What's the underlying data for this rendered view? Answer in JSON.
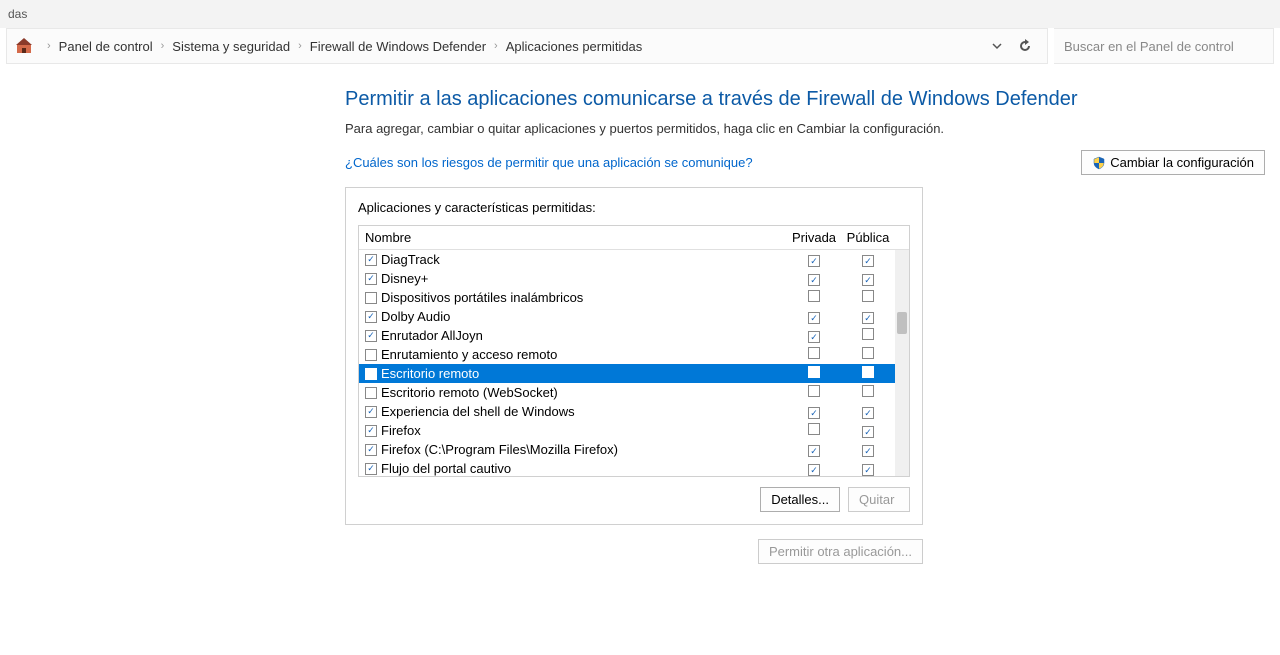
{
  "titlebar": {
    "text": "das"
  },
  "breadcrumb": {
    "items": [
      "Panel de control",
      "Sistema y seguridad",
      "Firewall de Windows Defender",
      "Aplicaciones permitidas"
    ]
  },
  "search": {
    "placeholder": "Buscar en el Panel de control"
  },
  "page": {
    "title": "Permitir a las aplicaciones comunicarse a través de Firewall de Windows Defender",
    "description": "Para agregar, cambiar o quitar aplicaciones y puertos permitidos, haga clic en Cambiar la configuración.",
    "help_link": "¿Cuáles son los riesgos de permitir que una aplicación se comunique?",
    "change_settings_label": "Cambiar la configuración"
  },
  "panel": {
    "label": "Aplicaciones y características permitidas:",
    "columns": {
      "name": "Nombre",
      "private": "Privada",
      "public": "Pública"
    },
    "rows": [
      {
        "enabled": true,
        "name": "DiagTrack",
        "private": true,
        "public": true,
        "selected": false
      },
      {
        "enabled": true,
        "name": "Disney+",
        "private": true,
        "public": true,
        "selected": false
      },
      {
        "enabled": false,
        "name": "Dispositivos portátiles inalámbricos",
        "private": false,
        "public": false,
        "selected": false
      },
      {
        "enabled": true,
        "name": "Dolby Audio",
        "private": true,
        "public": true,
        "selected": false
      },
      {
        "enabled": true,
        "name": "Enrutador AllJoyn",
        "private": true,
        "public": false,
        "selected": false
      },
      {
        "enabled": false,
        "name": "Enrutamiento y acceso remoto",
        "private": false,
        "public": false,
        "selected": false
      },
      {
        "enabled": false,
        "name": "Escritorio remoto",
        "private": false,
        "public": false,
        "selected": true
      },
      {
        "enabled": false,
        "name": "Escritorio remoto (WebSocket)",
        "private": false,
        "public": false,
        "selected": false
      },
      {
        "enabled": true,
        "name": "Experiencia del shell de Windows",
        "private": true,
        "public": true,
        "selected": false
      },
      {
        "enabled": true,
        "name": "Firefox",
        "private": false,
        "public": true,
        "selected": false
      },
      {
        "enabled": true,
        "name": "Firefox (C:\\Program Files\\Mozilla Firefox)",
        "private": true,
        "public": true,
        "selected": false
      },
      {
        "enabled": true,
        "name": "Flujo del portal cautivo",
        "private": true,
        "public": true,
        "selected": false
      }
    ],
    "details_label": "Detalles...",
    "remove_label": "Quitar"
  },
  "allow_another_label": "Permitir otra aplicación..."
}
